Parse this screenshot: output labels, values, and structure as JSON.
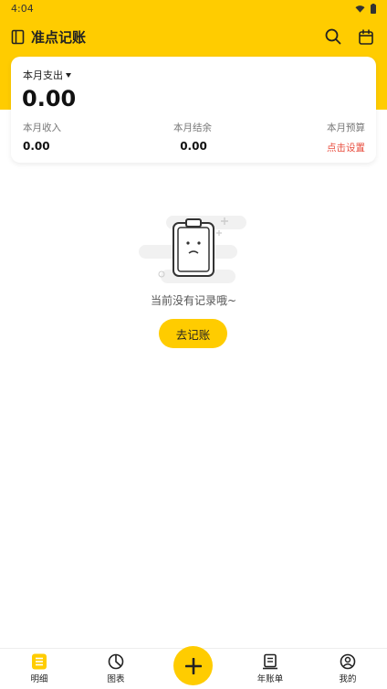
{
  "status_bar": {
    "time": "4:04"
  },
  "header": {
    "title": "准点记账"
  },
  "summary": {
    "month_label": "本月支出",
    "total_expense": "0.00",
    "income_label": "本月收入",
    "income_value": "0.00",
    "balance_label": "本月结余",
    "balance_value": "0.00",
    "budget_label": "本月预算",
    "budget_link": "点击设置"
  },
  "empty_state": {
    "message": "当前没有记录哦~",
    "button_label": "去记账"
  },
  "tabs": [
    {
      "label": "明细",
      "icon": "list-icon"
    },
    {
      "label": "图表",
      "icon": "pie-chart-icon"
    },
    {
      "label": "",
      "icon": "plus-icon"
    },
    {
      "label": "年账单",
      "icon": "bill-icon"
    },
    {
      "label": "我的",
      "icon": "profile-icon"
    }
  ],
  "colors": {
    "accent": "#FFCC00",
    "link": "#E84C3D"
  }
}
